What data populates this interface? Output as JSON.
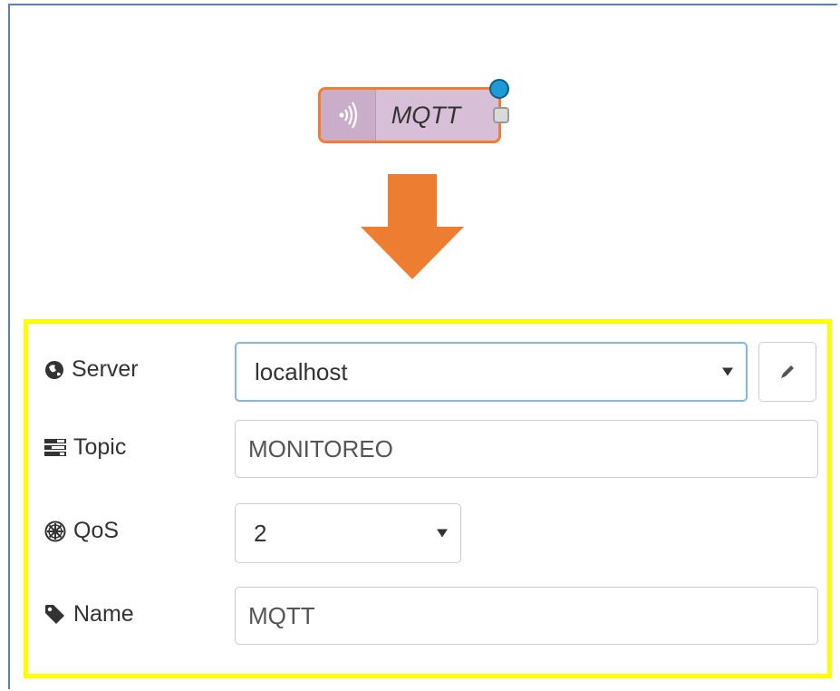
{
  "node": {
    "label": "MQTT",
    "icon": "radio-waves-icon",
    "color_fill": "#d8bfd8",
    "color_border": "#f07e2e",
    "status_color": "#1e9ad6"
  },
  "arrow": {
    "color": "#ed7d31"
  },
  "form": {
    "server": {
      "label": "Server",
      "icon": "globe-icon",
      "value": "localhost",
      "edit_icon": "pencil-icon"
    },
    "topic": {
      "label": "Topic",
      "icon": "tasks-icon",
      "value": "MONITOREO"
    },
    "qos": {
      "label": "QoS",
      "icon": "empire-icon",
      "value": "2"
    },
    "name": {
      "label": "Name",
      "icon": "tag-icon",
      "value": "MQTT"
    }
  },
  "highlight_color": "#ffff00"
}
